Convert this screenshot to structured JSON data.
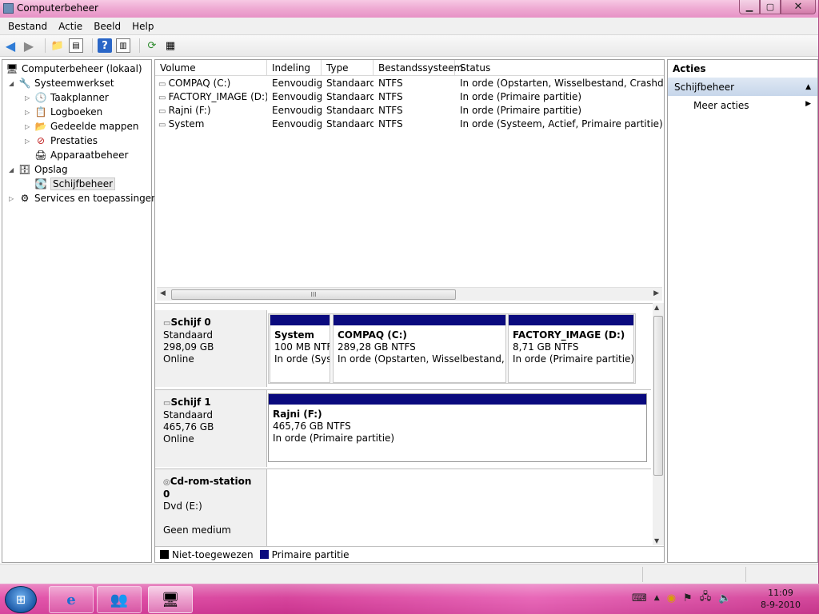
{
  "window": {
    "title": "Computerbeheer",
    "controls": {
      "minimize": "▁",
      "maximize": "▢",
      "close": "✕"
    }
  },
  "menu": [
    "Bestand",
    "Actie",
    "Beeld",
    "Help"
  ],
  "toolbar": {
    "icons": [
      "back-icon",
      "forward-icon",
      "up-folder-icon",
      "show-hide-tree-icon",
      "help-icon",
      "show-hide-action-icon",
      "refresh-icon",
      "properties-icon"
    ]
  },
  "tree": {
    "root": "Computerbeheer (lokaal)",
    "items": [
      {
        "label": "Systeemwerkset",
        "icon": "tools-icon"
      },
      {
        "label": "Taakplanner",
        "icon": "clock-icon"
      },
      {
        "label": "Logboeken",
        "icon": "event-viewer-icon"
      },
      {
        "label": "Gedeelde mappen",
        "icon": "shared-folders-icon"
      },
      {
        "label": "Prestaties",
        "icon": "performance-icon"
      },
      {
        "label": "Apparaatbeheer",
        "icon": "device-manager-icon"
      },
      {
        "label": "Opslag",
        "icon": "storage-icon"
      },
      {
        "label": "Schijfbeheer",
        "icon": "disk-management-icon"
      },
      {
        "label": "Services en toepassingen",
        "icon": "services-icon"
      }
    ]
  },
  "volumes": {
    "columns": [
      "Volume",
      "Indeling",
      "Type",
      "Bestandssysteem",
      "Status"
    ],
    "rows": [
      {
        "volume": "COMPAQ (C:)",
        "layout": "Eenvoudig",
        "type": "Standaard",
        "fs": "NTFS",
        "status": "In orde (Opstarten, Wisselbestand, Crashdump, P"
      },
      {
        "volume": "FACTORY_IMAGE (D:)",
        "layout": "Eenvoudig",
        "type": "Standaard",
        "fs": "NTFS",
        "status": "In orde (Primaire partitie)"
      },
      {
        "volume": "Rajni (F:)",
        "layout": "Eenvoudig",
        "type": "Standaard",
        "fs": "NTFS",
        "status": "In orde (Primaire partitie)"
      },
      {
        "volume": "System",
        "layout": "Eenvoudig",
        "type": "Standaard",
        "fs": "NTFS",
        "status": "In orde (Systeem, Actief, Primaire partitie)"
      }
    ],
    "scroll_grip": "III"
  },
  "disks": [
    {
      "name": "Schijf 0",
      "type": "Standaard",
      "size": "298,09 GB",
      "state": "Online",
      "partitions": [
        {
          "name": "System",
          "size": "100 MB NTF",
          "status": "In orde (Syst"
        },
        {
          "name": "COMPAQ  (C:)",
          "size": "289,28 GB NTFS",
          "status": "In orde (Opstarten, Wisselbestand, Cras"
        },
        {
          "name": "FACTORY_IMAGE  (D:)",
          "size": "8,71 GB NTFS",
          "status": "In orde (Primaire partitie)"
        }
      ]
    },
    {
      "name": "Schijf 1",
      "type": "Standaard",
      "size": "465,76 GB",
      "state": "Online",
      "partitions": [
        {
          "name": "Rajni  (F:)",
          "size": "465,76 GB NTFS",
          "status": "In orde (Primaire partitie)"
        }
      ]
    },
    {
      "name": "Cd-rom-station 0",
      "type": "Dvd (E:)",
      "size": "",
      "state": "Geen medium"
    }
  ],
  "legend": [
    {
      "label": "Niet-toegewezen",
      "color": "#000000"
    },
    {
      "label": "Primaire partitie",
      "color": "#0a0a7e"
    }
  ],
  "actions": {
    "header": "Acties",
    "section": "Schijfbeheer",
    "items": [
      "Meer acties"
    ]
  },
  "taskbar": {
    "apps": [
      "internet-explorer-icon",
      "users-icon",
      "computer-management-icon"
    ],
    "clock_time": "11:09",
    "clock_date": "8-9-2010"
  }
}
